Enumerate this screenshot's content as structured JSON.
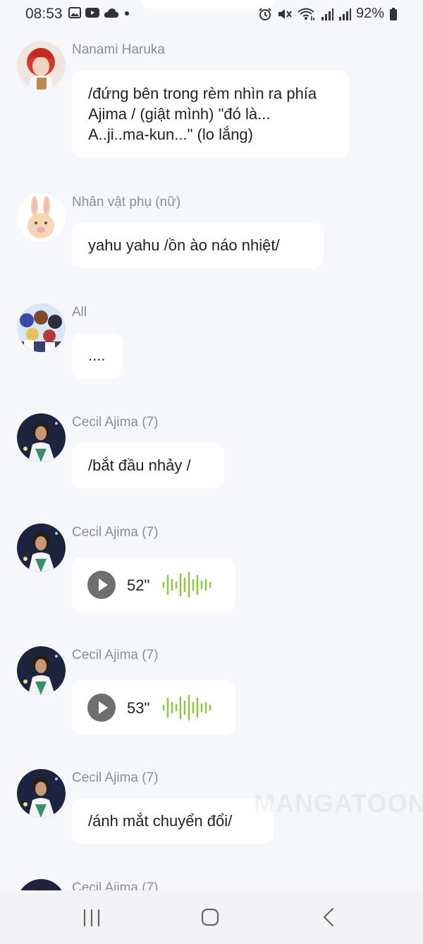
{
  "status_bar": {
    "time": "08:53",
    "battery": "92%",
    "left_icons": [
      "gallery-icon",
      "youtube-icon",
      "cloud-icon",
      "dot-icon"
    ],
    "right_icons": [
      "alarm-icon",
      "mute-icon",
      "wifi-icon",
      "signal-icon",
      "signal-icon",
      "battery-icon"
    ]
  },
  "messages": [
    {
      "sender": "Nanami Haruka",
      "text": "/đứng bên trong rèm nhìn ra phía Ajima / (giật mình) \"đó là... A..ji..ma-kun...\" (lo lắng)"
    },
    {
      "sender": "Nhân vật phụ (nữ)",
      "text": "yahu yahu /ồn ào náo nhiệt/"
    },
    {
      "sender": "All",
      "text": "...."
    },
    {
      "sender": "Cecil Ajima (7)",
      "text": "/bắt đầu nhảy /"
    },
    {
      "sender": "Cecil Ajima (7)",
      "voice_duration": "52\""
    },
    {
      "sender": "Cecil Ajima (7)",
      "voice_duration": "53\""
    },
    {
      "sender": "Cecil Ajima (7)",
      "text": "/ánh mắt chuyển đổi/"
    },
    {
      "sender": "Cecil Ajima (7)"
    }
  ],
  "watermark": "MANGATOON",
  "colors": {
    "background": "#f6f7fa",
    "bubble": "#ffffff",
    "name": "#8e8e93",
    "waveform": "#8dc63f",
    "play_button": "#6f6f6f"
  },
  "nav": {
    "recents": "recents-icon",
    "home": "home-icon",
    "back": "back-icon"
  }
}
